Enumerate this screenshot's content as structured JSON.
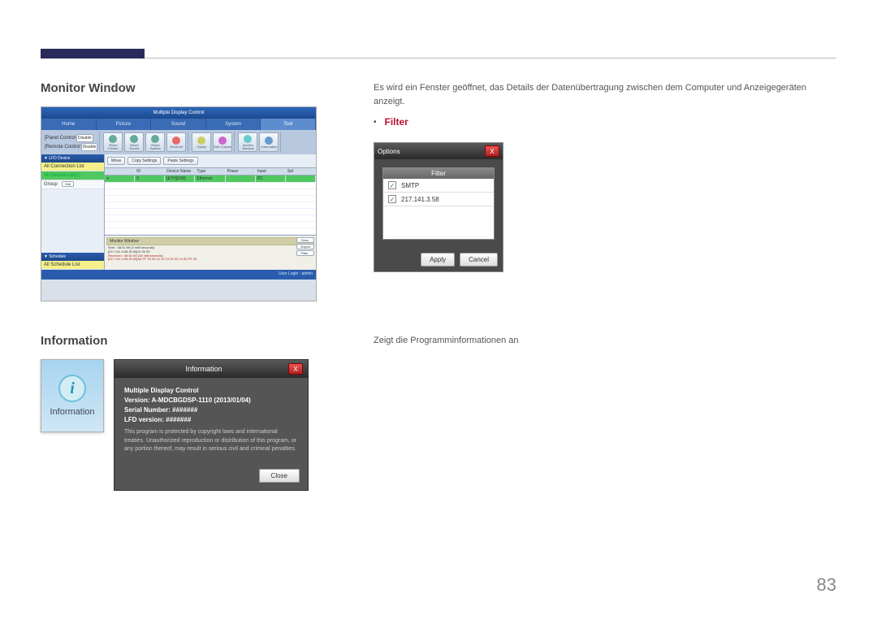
{
  "page": {
    "number": "83"
  },
  "section1": {
    "title": "Monitor Window",
    "desc": "Es wird ein Fenster geöffnet, das Details der Datenübertragung zwischen dem Computer und Anzeigegeräten anzeigt.",
    "filter_label": "Filter"
  },
  "app": {
    "title": "Multiple Display Control",
    "tabs": [
      "Home",
      "Picture",
      "Sound",
      "System",
      "Tool"
    ],
    "active_tab": 4,
    "tool_left_label1": "[Panel Control",
    "tool_left_label2": "[Remote Control",
    "tool_left_val1": "Disable",
    "tool_left_val2": "Disable",
    "tool_btns": [
      "Reset Picture",
      "Reset Sound",
      "Reset System",
      "Reset All",
      "Option",
      "Edit Column",
      "Monitor Window",
      "Information"
    ],
    "action_btns": [
      "Move",
      "Copy Settings",
      "Paste Settings"
    ],
    "side_hdr1": "▼ LFD Device",
    "side_items1": [
      "All Connection List",
      "All Device List(1)"
    ],
    "side_group": "Group",
    "side_edit": "Edit",
    "side_hdr2": "▼ Schedule",
    "side_item2": "All Schedule List",
    "grid_cols": [
      "",
      "ID",
      "Device Name",
      "Type",
      "Power",
      "Input",
      "Sel"
    ],
    "grid_row": [
      "✔",
      "0",
      "[ETH]0000",
      "Ethernet",
      "",
      "PC",
      ""
    ],
    "mon_title": "Monitor Window",
    "mon_sent": "Sent : 08:51:99 (0 milli seconds)",
    "mon_addr": "[217.141.3.58 ID:00]11 00 00",
    "mon_recv": "Received : 08:51:99 (16 milli seconds)",
    "mon_recv2": "[217.141.3.58 ID:00]AA FF 00 09 41 42 01 00 00 14 00 FE 2E",
    "mon_btns": [
      "Clear",
      "Export",
      "Filter"
    ],
    "status": "User Login : admin"
  },
  "filter_dlg": {
    "title": "Options",
    "hdr": "Filter",
    "row1": "SMTP",
    "row2": "217.141.3.58",
    "apply": "Apply",
    "cancel": "Cancel",
    "close": "X"
  },
  "section2": {
    "title": "Information",
    "desc": "Zeigt die Programminformationen an",
    "icon_label": "Information"
  },
  "info_dlg": {
    "title": "Information",
    "close_x": "X",
    "line1": "Multiple Display Control",
    "line2": "Version: A-MDCBGDSP-1110 (2013/01/04)",
    "line3": "Serial Number: #######",
    "line4": "LFD version: #######",
    "warn": "This program is protected by copyright laws and international treaties. Unauthorized reproduction or distribution of this program, or any portion thereof, may result in serious civil and criminal penalties.",
    "close": "Close"
  }
}
